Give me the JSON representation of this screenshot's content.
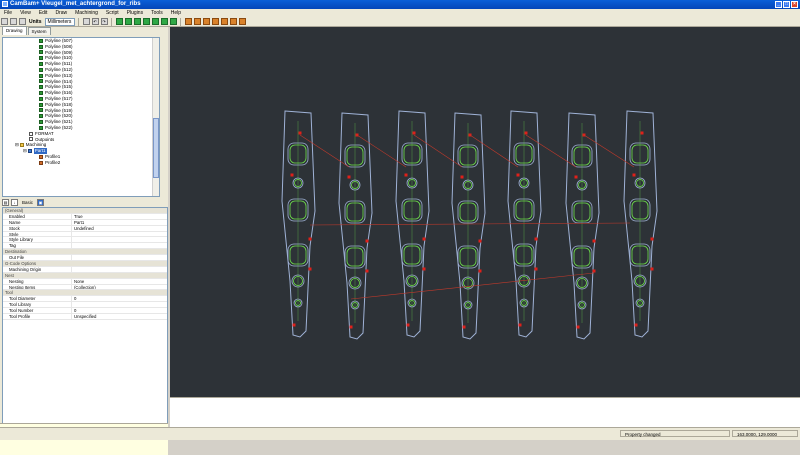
{
  "window": {
    "title": "CamBam+ Vleugel_met_achtergrond_for_ribs"
  },
  "menu": [
    "File",
    "View",
    "Edit",
    "Draw",
    "Machining",
    "Script",
    "Plugins",
    "Tools",
    "Help"
  ],
  "toolbar": {
    "units_label": "Units",
    "units_value": "Millimeters"
  },
  "tabs": [
    "Drawing",
    "System"
  ],
  "tree": {
    "polylines": [
      "Polyline (507)",
      "Polyline (508)",
      "Polyline (509)",
      "Polyline (510)",
      "Polyline (511)",
      "Polyline (512)",
      "Polyline (513)",
      "Polyline (514)",
      "Polyline (515)",
      "Polyline (516)",
      "Polyline (517)",
      "Polyline (518)",
      "Polyline (519)",
      "Polyline (520)",
      "Polyline (521)",
      "Polyline (522)"
    ],
    "format": "FORMAT",
    "outpoints": "Outpoints",
    "machining": "Machining",
    "part": "Part1",
    "profiles": [
      "Profile1",
      "Profile2"
    ]
  },
  "props_toolbar": {
    "basic_label": "Basic"
  },
  "properties": [
    {
      "cat": "(General)"
    },
    {
      "k": "Enabled",
      "v": "True"
    },
    {
      "k": "Name",
      "v": "Part1"
    },
    {
      "k": "Stock",
      "v": "Undefined"
    },
    {
      "k": "Style",
      "v": ""
    },
    {
      "k": "Style Library",
      "v": ""
    },
    {
      "k": "Tag",
      "v": ""
    },
    {
      "cat": "Destination"
    },
    {
      "k": "Out File",
      "v": ""
    },
    {
      "cat": "G-Code Options"
    },
    {
      "k": "Machining Origin",
      "v": ""
    },
    {
      "cat": "Nest"
    },
    {
      "k": "Nesting",
      "v": "None"
    },
    {
      "k": "Nesting Items",
      "v": "(Collection)"
    },
    {
      "cat": "Tool"
    },
    {
      "k": "Tool Diameter",
      "v": "0"
    },
    {
      "k": "Tool Library",
      "v": ""
    },
    {
      "k": "Tool Number",
      "v": "0"
    },
    {
      "k": "Tool Profile",
      "v": "Unspecified"
    }
  ],
  "status": {
    "message": "Property changed",
    "coords": "163.0000, 129.0000"
  },
  "colors": {
    "canvas_bg": "#2d3237",
    "outline": "#9fb2d6",
    "toolpath": "#6ee04a",
    "marker": "#e0201a",
    "link": "#c0392b"
  }
}
